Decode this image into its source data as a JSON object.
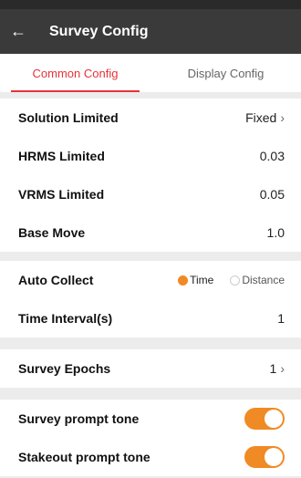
{
  "header": {
    "title": "Survey Config"
  },
  "tabs": [
    {
      "label": "Common Config"
    },
    {
      "label": "Display Config"
    }
  ],
  "rows": {
    "solution": {
      "label": "Solution Limited",
      "value": "Fixed"
    },
    "hrms": {
      "label": "HRMS Limited",
      "value": "0.03"
    },
    "vrms": {
      "label": "VRMS Limited",
      "value": "0.05"
    },
    "base_move": {
      "label": "Base Move",
      "value": "1.0"
    },
    "auto_collect": {
      "label": "Auto Collect",
      "options": [
        "Time",
        "Distance"
      ],
      "selected": "Time"
    },
    "time_interval": {
      "label": "Time Interval(s)",
      "value": "1"
    },
    "epochs": {
      "label": "Survey Epochs",
      "value": "1"
    },
    "survey_tone": {
      "label": "Survey prompt tone",
      "enabled": true
    },
    "stakeout_tone": {
      "label": "Stakeout prompt tone",
      "enabled": true
    }
  },
  "colors": {
    "accent": "#e8313a",
    "toggle": "#f08a24",
    "appbar": "#3a3a3a"
  }
}
